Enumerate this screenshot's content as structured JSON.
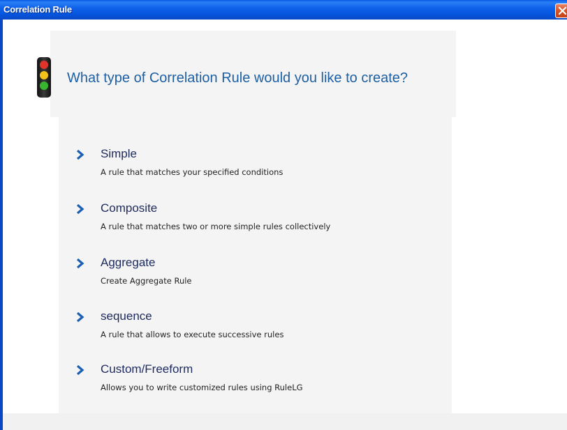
{
  "window": {
    "title": "Correlation Rule"
  },
  "prompt": {
    "title": "What type of Correlation Rule would you like to create?"
  },
  "options": [
    {
      "label": "Simple",
      "description": "A rule that matches your specified conditions"
    },
    {
      "label": "Composite",
      "description": "A rule that matches two or more simple rules collectively"
    },
    {
      "label": "Aggregate",
      "description": "Create Aggregate Rule"
    },
    {
      "label": "sequence",
      "description": "A rule that allows to execute successive rules"
    },
    {
      "label": "Custom/Freeform",
      "description": "Allows you to write customized rules using RuleLG"
    }
  ],
  "icons": {
    "header": "traffic-light-icon",
    "option": "chevron-right-icon",
    "close": "close-icon"
  },
  "colors": {
    "titlebar": "#0654dc",
    "prompt_text": "#1d5fa3",
    "option_label": "#1d2a5c",
    "chevron": "#1a5fb4",
    "panel_background": "#f4f4f4"
  }
}
